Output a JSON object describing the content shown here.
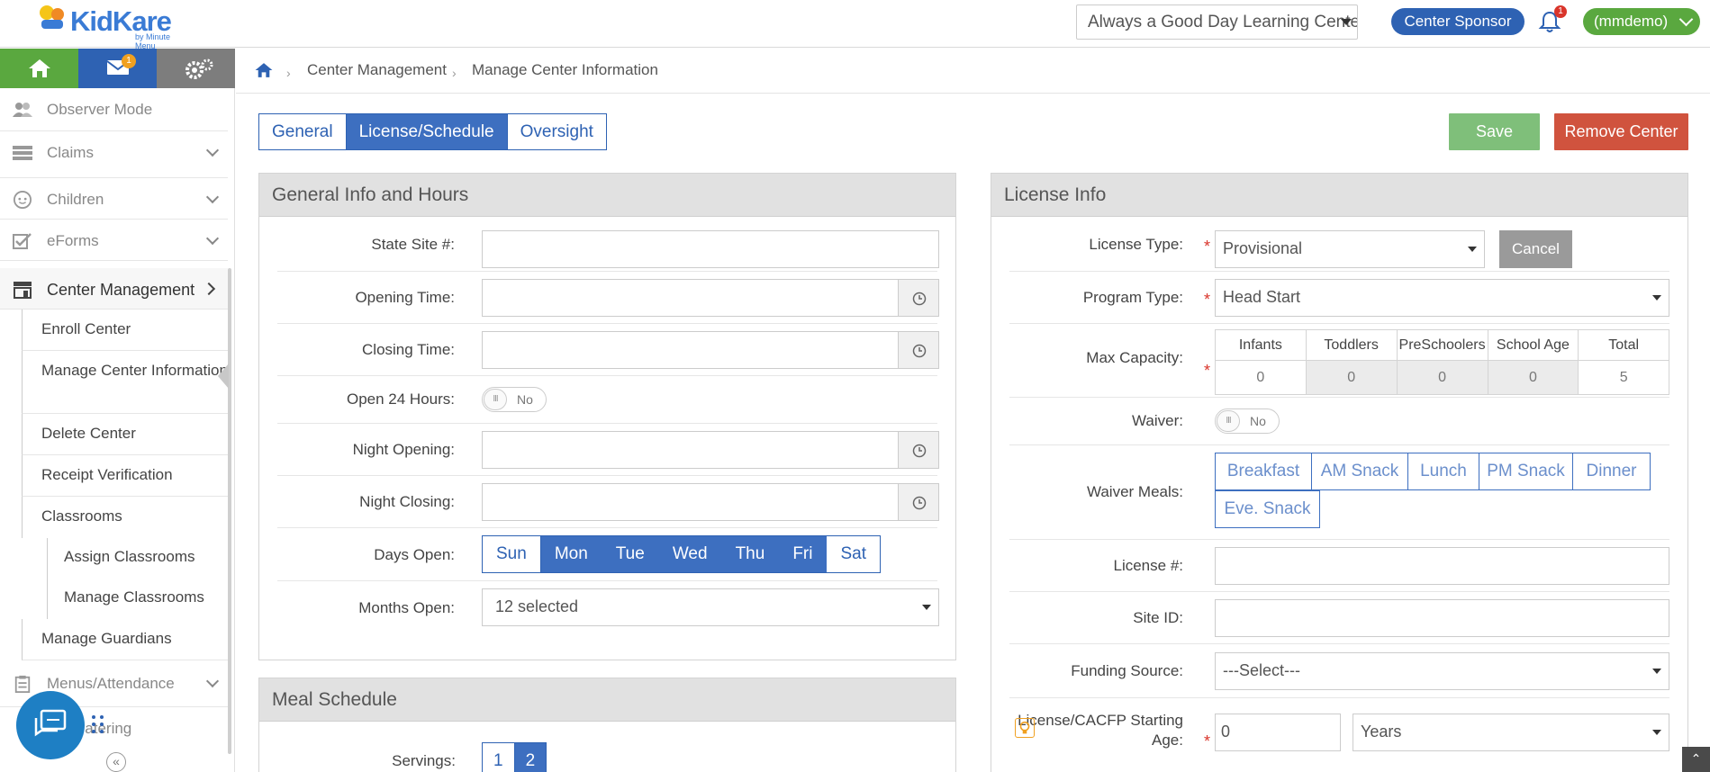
{
  "topbar": {
    "brand": "KidKare",
    "brand_sub": "by Minute Menu",
    "center_select_value": "Always a Good Day Learning Center",
    "sponsor_label": "Center Sponsor",
    "notification_count": "1",
    "user_label": "(mmdemo)"
  },
  "sidebar": {
    "mail_badge": "1",
    "items": [
      {
        "label": "Observer Mode"
      },
      {
        "label": "Claims"
      },
      {
        "label": "Children"
      },
      {
        "label": "eForms"
      },
      {
        "label": "Center Management"
      }
    ],
    "sub_items": [
      "Enroll Center",
      "Manage Center Information",
      "Delete Center",
      "Receipt Verification",
      "Classrooms"
    ],
    "sub_sub_items": [
      "Assign Classrooms",
      "Manage Classrooms"
    ],
    "sub_items_after": [
      "Manage Guardians"
    ],
    "items_after": [
      {
        "label": "Menus/Attendance"
      },
      {
        "label": "Catering"
      }
    ]
  },
  "breadcrumb": {
    "level1": "Center Management",
    "level2": "Manage Center Information"
  },
  "tabs": [
    "General",
    "License/Schedule",
    "Oversight"
  ],
  "active_tab": "License/Schedule",
  "actions": {
    "save": "Save",
    "remove": "Remove Center"
  },
  "general_panel": {
    "title": "General Info and Hours",
    "state_site_label": "State Site #:",
    "opening_time_label": "Opening Time:",
    "closing_time_label": "Closing Time:",
    "open_24_label": "Open 24 Hours:",
    "open_24_value": "No",
    "night_opening_label": "Night Opening:",
    "night_closing_label": "Night Closing:",
    "days_open_label": "Days Open:",
    "days": [
      {
        "label": "Sun",
        "selected": false
      },
      {
        "label": "Mon",
        "selected": true
      },
      {
        "label": "Tue",
        "selected": true
      },
      {
        "label": "Wed",
        "selected": true
      },
      {
        "label": "Thu",
        "selected": true
      },
      {
        "label": "Fri",
        "selected": true
      },
      {
        "label": "Sat",
        "selected": false
      }
    ],
    "months_open_label": "Months Open:",
    "months_open_value": "12 selected"
  },
  "meal_panel": {
    "title": "Meal Schedule",
    "servings_label": "Servings:",
    "servings_options": [
      "1",
      "2"
    ],
    "servings_selected": "2"
  },
  "license_panel": {
    "title": "License Info",
    "license_type_label": "License Type:",
    "license_type_value": "Provisional",
    "cancel_label": "Cancel",
    "program_type_label": "Program Type:",
    "program_type_value": "Head Start",
    "max_capacity_label": "Max Capacity:",
    "capacity_headers": [
      "Infants",
      "Toddlers",
      "PreSchoolers",
      "School Age",
      "Total"
    ],
    "capacity_values": [
      "0",
      "0",
      "0",
      "0",
      "5"
    ],
    "waiver_label": "Waiver:",
    "waiver_value": "No",
    "waiver_meals_label": "Waiver Meals:",
    "waiver_meals": [
      "Breakfast",
      "AM Snack",
      "Lunch",
      "PM Snack",
      "Dinner",
      "Eve. Snack"
    ],
    "license_no_label": "License #:",
    "site_id_label": "Site ID:",
    "funding_source_label": "Funding Source:",
    "funding_source_value": "---Select---",
    "starting_age_label_1": "License/CACFP Starting",
    "starting_age_label_2": "Age:",
    "starting_age_value": "0",
    "starting_age_unit": "Years"
  },
  "colors": {
    "brand_blue": "#2e62b3",
    "brand_green": "#5aa83f",
    "save_green": "#7fbf7a",
    "remove_red": "#d0533e"
  }
}
